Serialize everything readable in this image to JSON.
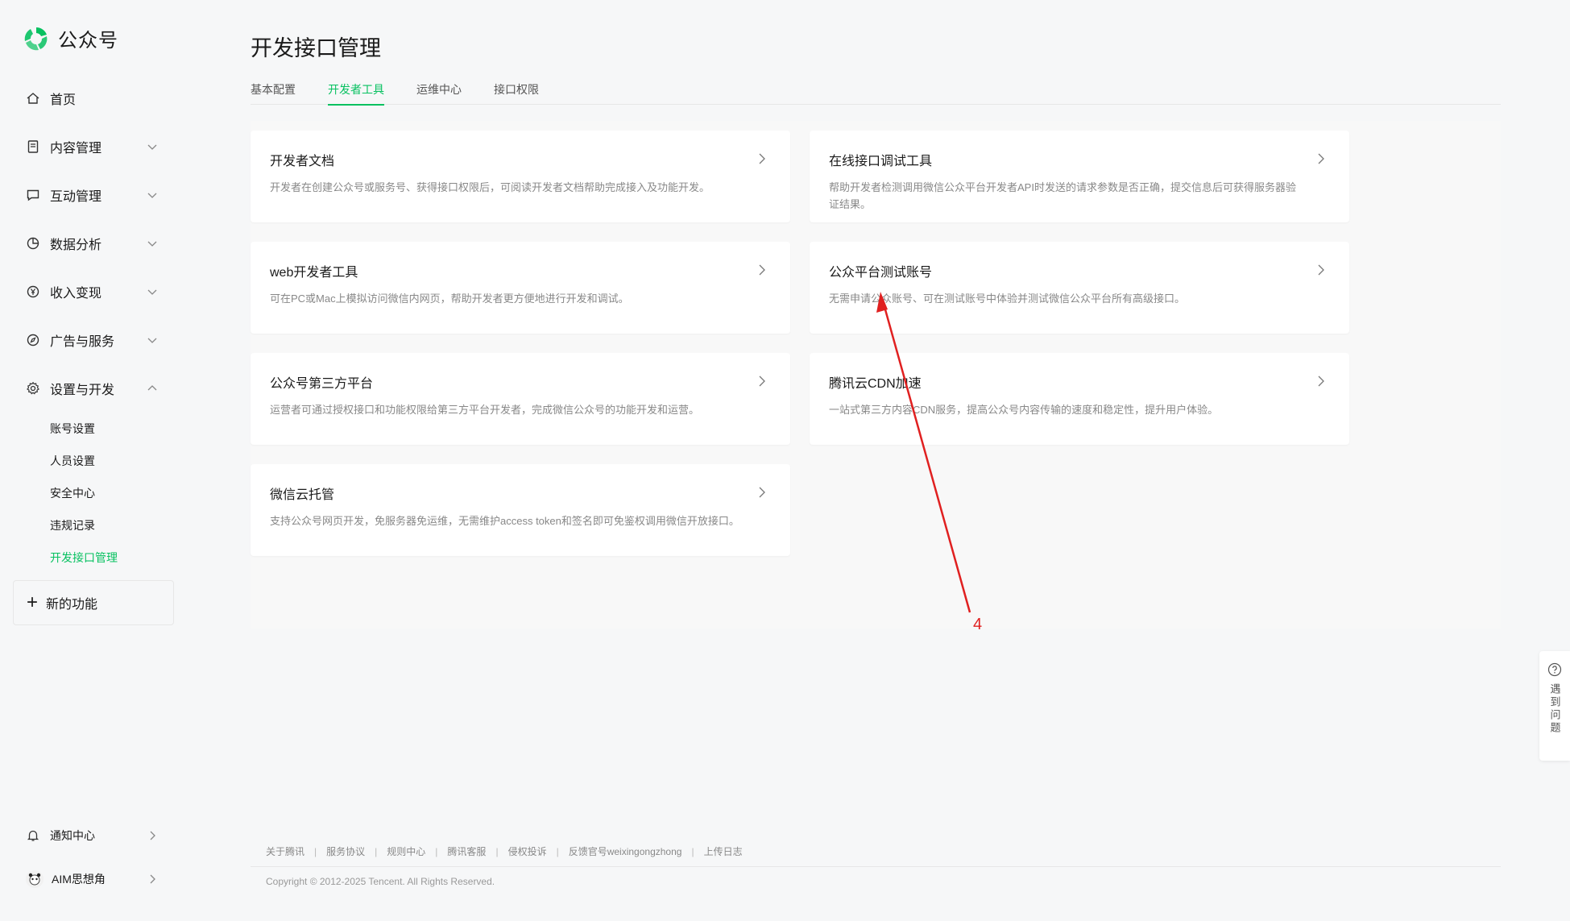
{
  "app": {
    "name": "公众号",
    "brand_color": "#07c160"
  },
  "sidebar": {
    "items": [
      {
        "label": "首页",
        "icon": "home-icon",
        "expandable": false
      },
      {
        "label": "内容管理",
        "icon": "document-icon",
        "expandable": true
      },
      {
        "label": "互动管理",
        "icon": "chat-icon",
        "expandable": true
      },
      {
        "label": "数据分析",
        "icon": "pie-chart-icon",
        "expandable": true
      },
      {
        "label": "收入变现",
        "icon": "yen-icon",
        "expandable": true
      },
      {
        "label": "广告与服务",
        "icon": "compass-icon",
        "expandable": true
      },
      {
        "label": "设置与开发",
        "icon": "gear-icon",
        "expandable": true,
        "expanded": true
      }
    ],
    "sub_items": [
      {
        "label": "账号设置"
      },
      {
        "label": "人员设置"
      },
      {
        "label": "安全中心"
      },
      {
        "label": "违规记录"
      },
      {
        "label": "开发接口管理",
        "active": true
      }
    ],
    "new_feature": "新的功能",
    "bottom": [
      {
        "label": "通知中心",
        "icon": "bell-icon"
      },
      {
        "label": "AIM思想角",
        "icon": "avatar"
      }
    ]
  },
  "main": {
    "title": "开发接口管理",
    "tabs": [
      {
        "label": "基本配置"
      },
      {
        "label": "开发者工具",
        "active": true
      },
      {
        "label": "运维中心"
      },
      {
        "label": "接口权限"
      }
    ],
    "cards": [
      {
        "title": "开发者文档",
        "desc": "开发者在创建公众号或服务号、获得接口权限后，可阅读开发者文档帮助完成接入及功能开发。"
      },
      {
        "title": "在线接口调试工具",
        "desc": "帮助开发者检测调用微信公众平台开发者API时发送的请求参数是否正确，提交信息后可获得服务器验证结果。"
      },
      {
        "title": "web开发者工具",
        "desc": "可在PC或Mac上模拟访问微信内网页，帮助开发者更方便地进行开发和调试。"
      },
      {
        "title": "公众平台测试账号",
        "desc": "无需申请公众账号、可在测试账号中体验并测试微信公众平台所有高级接口。"
      },
      {
        "title": "公众号第三方平台",
        "desc": "运营者可通过授权接口和功能权限给第三方平台开发者，完成微信公众号的功能开发和运营。"
      },
      {
        "title": "腾讯云CDN加速",
        "desc": "一站式第三方内容CDN服务，提高公众号内容传输的速度和稳定性，提升用户体验。"
      },
      {
        "title": "微信云托管",
        "desc": "支持公众号网页开发，免服务器免运维，无需维护access token和签名即可免鉴权调用微信开放接口。"
      }
    ]
  },
  "footer": {
    "links": [
      "关于腾讯",
      "服务协议",
      "规则中心",
      "腾讯客服",
      "侵权投诉",
      "反馈官号weixingongzhong",
      "上传日志"
    ],
    "copyright": "Copyright © 2012-2025 Tencent. All Rights Reserved."
  },
  "help": {
    "label": "遇到问题"
  },
  "annotation": {
    "number": "4",
    "color": "#e02020"
  }
}
